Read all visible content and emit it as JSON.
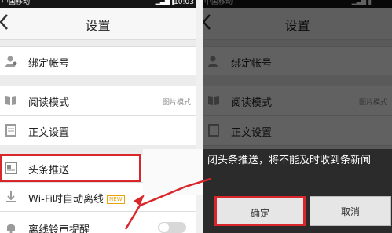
{
  "status_bar": {
    "carrier": "中国移动",
    "time": "10:03"
  },
  "header": {
    "back_label": "‹",
    "title": "设置"
  },
  "settings": {
    "bind_account": {
      "label": "绑定帐号",
      "icon": "user-icon"
    },
    "reading_mode": {
      "label": "阅读模式",
      "value": "图片模式",
      "icon": "book-icon"
    },
    "text_settings": {
      "label": "正文设置",
      "icon": "document-icon"
    },
    "headline_push": {
      "label": "头条推送",
      "icon": "news-icon"
    },
    "wifi_offline": {
      "label": "Wi-Fi时自动离线",
      "badge": "NEW",
      "icon": "download-icon"
    },
    "offline_ringtone": {
      "label": "离线铃声提醒",
      "icon": "bell-icon"
    }
  },
  "dialog": {
    "message": "闭头条推送，将不能及时收到条新闻",
    "ok_label": "确定",
    "cancel_label": "取消"
  },
  "colors": {
    "highlight": "#d9262b",
    "badge": "#e9a30b"
  }
}
